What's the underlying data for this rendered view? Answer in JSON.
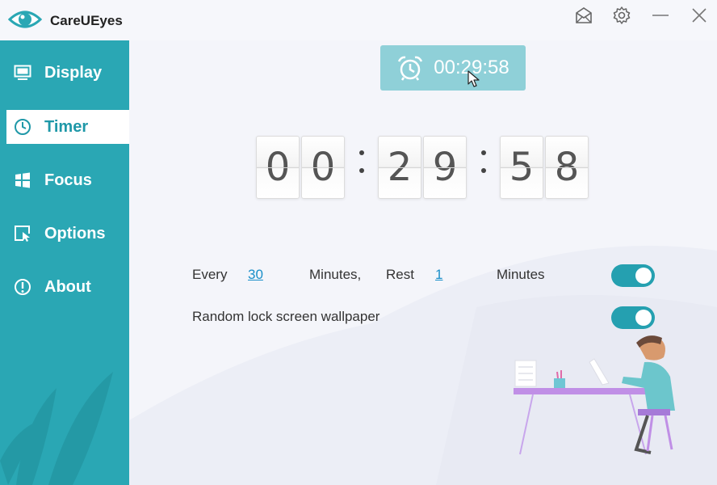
{
  "app": {
    "title": "CareUEyes"
  },
  "titlebar": {
    "icons": [
      "mail-icon",
      "settings-icon",
      "minimize-icon",
      "close-icon"
    ]
  },
  "sidebar": {
    "items": [
      {
        "label": "Display",
        "icon": "monitor-icon",
        "active": false
      },
      {
        "label": "Timer",
        "icon": "clock-icon",
        "active": true
      },
      {
        "label": "Focus",
        "icon": "windows-icon",
        "active": false
      },
      {
        "label": "Options",
        "icon": "cursor-window-icon",
        "active": false
      },
      {
        "label": "About",
        "icon": "info-icon",
        "active": false
      }
    ]
  },
  "timer": {
    "button_label": "00:29:58",
    "digits": [
      "0",
      "0",
      "2",
      "9",
      "5",
      "8"
    ]
  },
  "settings": {
    "rest_row": {
      "every": "Every",
      "every_value": "30",
      "minutes1": "Minutes,",
      "rest": "Rest",
      "rest_value": "1",
      "minutes2": "Minutes",
      "enabled": true
    },
    "wallpaper_row": {
      "label": "Random lock screen wallpaper",
      "enabled": true
    }
  },
  "colors": {
    "accent": "#2aa7b4",
    "timer_button": "#8fd0d8",
    "link": "#1a8fc9"
  }
}
